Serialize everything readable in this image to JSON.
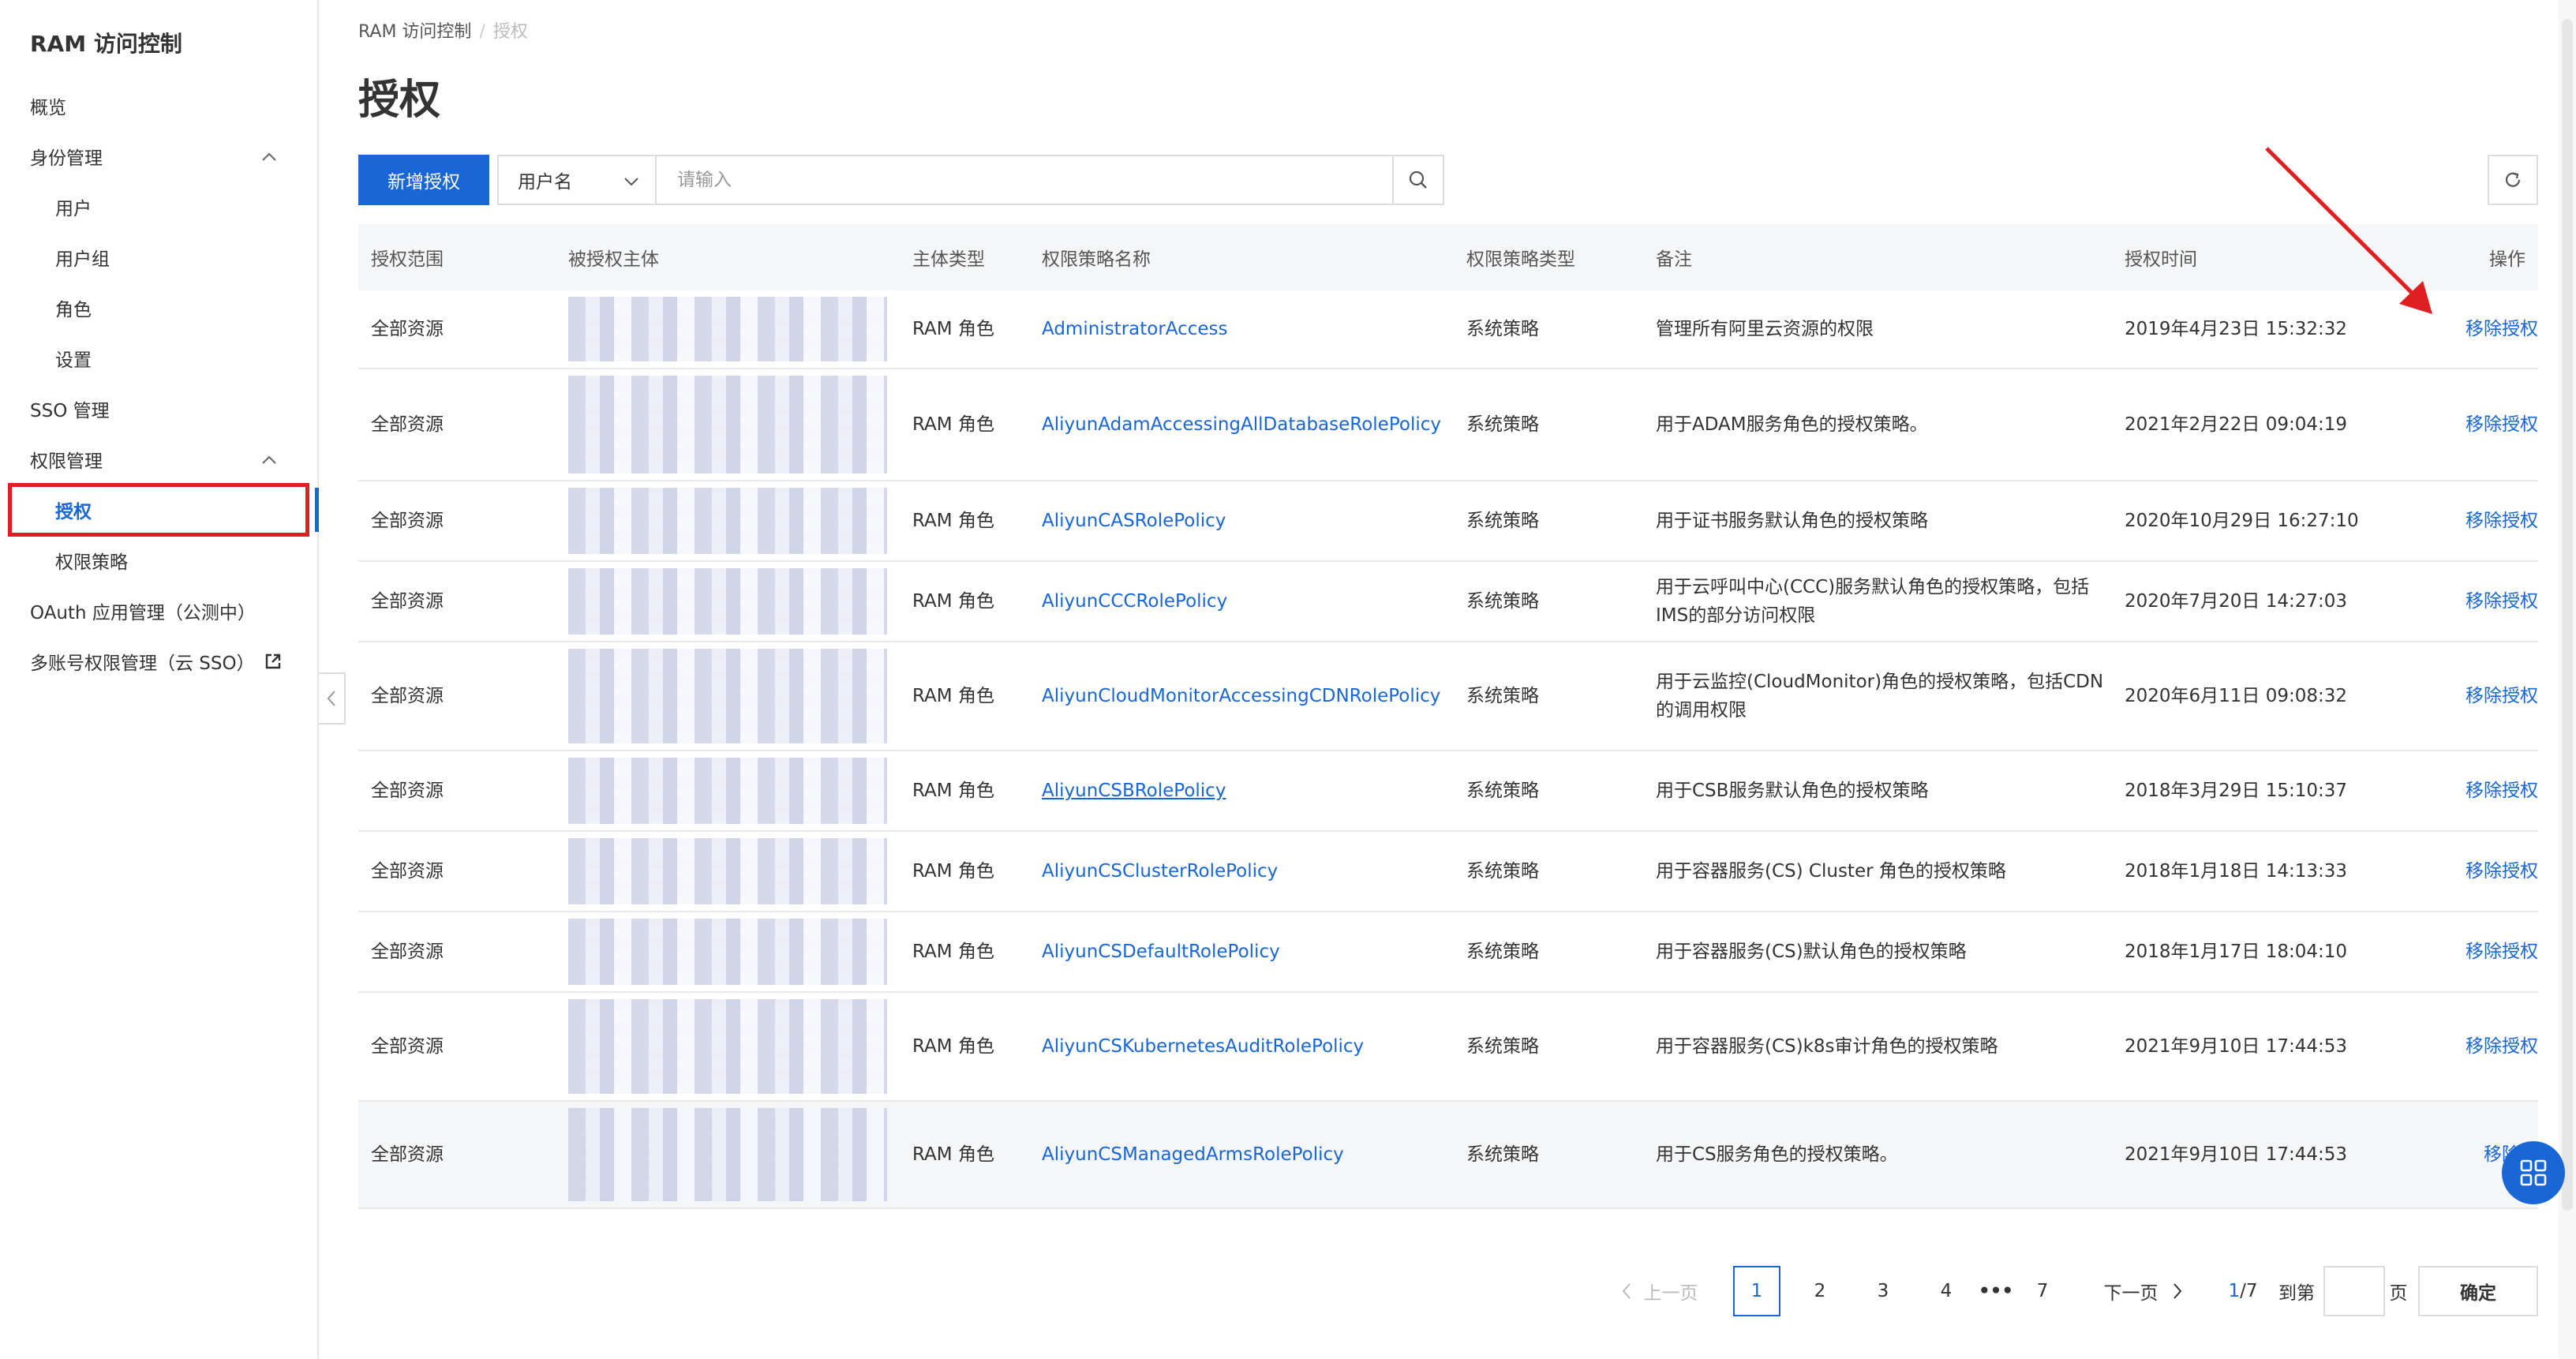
{
  "sidebar": {
    "title": "RAM 访问控制",
    "items": [
      {
        "label": "概览"
      },
      {
        "label": "身份管理"
      },
      {
        "label": "用户"
      },
      {
        "label": "用户组"
      },
      {
        "label": "角色"
      },
      {
        "label": "设置"
      },
      {
        "label": "SSO 管理"
      },
      {
        "label": "权限管理"
      },
      {
        "label": "授权"
      },
      {
        "label": "权限策略"
      },
      {
        "label": "OAuth 应用管理（公测中）"
      },
      {
        "label": "多账号权限管理（云 SSO）"
      }
    ],
    "active_item": "授权"
  },
  "breadcrumb": {
    "root": "RAM 访问控制",
    "current": "授权"
  },
  "page_title": "授权",
  "toolbar": {
    "add_label": "新增授权",
    "filter_select": "用户名",
    "search_placeholder": "请输入"
  },
  "table": {
    "headers": [
      "授权范围",
      "被授权主体",
      "主体类型",
      "权限策略名称",
      "权限策略类型",
      "备注",
      "授权时间",
      "操作"
    ],
    "rows": [
      {
        "scope": "全部资源",
        "type": "RAM 角色",
        "policy": "AdministratorAccess",
        "ptype": "系统策略",
        "note": "管理所有阿里云资源的权限",
        "time": "2019年4月23日 15:32:32",
        "action": "移除授权"
      },
      {
        "scope": "全部资源",
        "type": "RAM 角色",
        "policy": "AliyunAdamAccessingAllDatabaseRolePolicy",
        "ptype": "系统策略",
        "note": "用于ADAM服务角色的授权策略。",
        "time": "2021年2月22日 09:04:19",
        "action": "移除授权"
      },
      {
        "scope": "全部资源",
        "type": "RAM 角色",
        "policy": "AliyunCASRolePolicy",
        "ptype": "系统策略",
        "note": "用于证书服务默认角色的授权策略",
        "time": "2020年10月29日 16:27:10",
        "action": "移除授权"
      },
      {
        "scope": "全部资源",
        "type": "RAM 角色",
        "policy": "AliyunCCCRolePolicy",
        "ptype": "系统策略",
        "note": "用于云呼叫中心(CCC)服务默认角色的授权策略，包括IMS的部分访问权限",
        "time": "2020年7月20日 14:27:03",
        "action": "移除授权"
      },
      {
        "scope": "全部资源",
        "type": "RAM 角色",
        "policy": "AliyunCloudMonitorAccessingCDNRolePolicy",
        "ptype": "系统策略",
        "note": "用于云监控(CloudMonitor)角色的授权策略，包括CDN的调用权限",
        "time": "2020年6月11日 09:08:32",
        "action": "移除授权"
      },
      {
        "scope": "全部资源",
        "type": "RAM 角色",
        "policy": "AliyunCSBRolePolicy",
        "ptype": "系统策略",
        "note": "用于CSB服务默认角色的授权策略",
        "time": "2018年3月29日 15:10:37",
        "action": "移除授权"
      },
      {
        "scope": "全部资源",
        "type": "RAM 角色",
        "policy": "AliyunCSClusterRolePolicy",
        "ptype": "系统策略",
        "note": "用于容器服务(CS) Cluster 角色的授权策略",
        "time": "2018年1月18日 14:13:33",
        "action": "移除授权"
      },
      {
        "scope": "全部资源",
        "type": "RAM 角色",
        "policy": "AliyunCSDefaultRolePolicy",
        "ptype": "系统策略",
        "note": "用于容器服务(CS)默认角色的授权策略",
        "time": "2018年1月17日 18:04:10",
        "action": "移除授权"
      },
      {
        "scope": "全部资源",
        "type": "RAM 角色",
        "policy": "AliyunCSKubernetesAuditRolePolicy",
        "ptype": "系统策略",
        "note": "用于容器服务(CS)k8s审计角色的授权策略",
        "time": "2021年9月10日 17:44:53",
        "action": "移除授权"
      },
      {
        "scope": "全部资源",
        "type": "RAM 角色",
        "policy": "AliyunCSManagedArmsRolePolicy",
        "ptype": "系统策略",
        "note": "用于CS服务角色的授权策略。",
        "time": "2021年9月10日 17:44:53",
        "action": "移除授"
      }
    ]
  },
  "pagination": {
    "prev": "上一页",
    "pages": [
      "1",
      "2",
      "3",
      "4",
      "•••",
      "7"
    ],
    "current": "1",
    "next": "下一页",
    "current_label": "1",
    "total_label": "/7",
    "goto_label": "到第",
    "page_suffix": "页",
    "confirm": "确定"
  },
  "colors": {
    "accent": "#1966d6",
    "highlight": "#e02020"
  }
}
